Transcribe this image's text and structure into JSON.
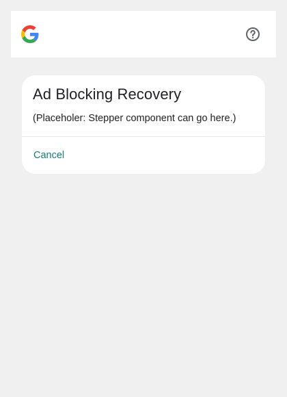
{
  "header": {
    "logo_icon": "google-g-icon",
    "help_icon": "help-circle-icon"
  },
  "dialog": {
    "title": "Ad Blocking Recovery",
    "body": "(Placeholer: Stepper component can go here.)",
    "cancel_label": "Cancel"
  },
  "colors": {
    "page_background": "#f0f0f0",
    "surface": "#ffffff",
    "text_primary": "#202124",
    "link_accent": "#137e75",
    "icon_gray": "#5f6368",
    "google_blue": "#4285F4",
    "google_red": "#EA4335",
    "google_yellow": "#FBBC05",
    "google_green": "#34A853"
  }
}
